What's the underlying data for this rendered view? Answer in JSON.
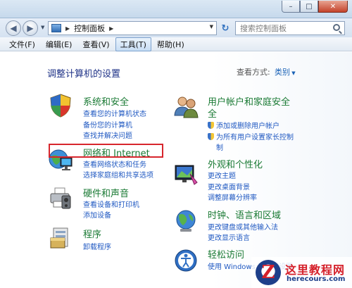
{
  "window": {
    "controls": {
      "min": "–",
      "max": "□",
      "close": "✕"
    }
  },
  "address_bar": {
    "location": "控制面板",
    "search_placeholder": "搜索控制面板"
  },
  "menu": [
    "文件(F)",
    "编辑(E)",
    "查看(V)",
    "工具(T)",
    "帮助(H)"
  ],
  "menu_active_index": 3,
  "main": {
    "title": "调整计算机的设置",
    "view_by_label": "查看方式:",
    "view_by_value": "类别"
  },
  "categories_left": [
    {
      "title": "系统和安全",
      "links": [
        "查看您的计算机状态",
        "备份您的计算机",
        "查找并解决问题"
      ],
      "icon": "shield-icon"
    },
    {
      "title": "网络和 Internet",
      "links": [
        "查看网络状态和任务",
        "选择家庭组和共享选项"
      ],
      "icon": "network-icon"
    },
    {
      "title": "硬件和声音",
      "links": [
        "查看设备和打印机",
        "添加设备"
      ],
      "icon": "printer-icon"
    },
    {
      "title": "程序",
      "links": [
        "卸载程序"
      ],
      "icon": "programs-icon"
    }
  ],
  "categories_right": [
    {
      "title": "用户帐户和家庭安全",
      "links": [
        "添加或删除用户帐户",
        "为所有用户设置家长控制"
      ],
      "icon": "users-icon"
    },
    {
      "title": "外观和个性化",
      "links": [
        "更改主题",
        "更改桌面背景",
        "调整屏幕分辨率"
      ],
      "icon": "appearance-icon"
    },
    {
      "title": "时钟、语言和区域",
      "links": [
        "更改键盘或其他输入法",
        "更改显示语言"
      ],
      "icon": "globe-icon"
    },
    {
      "title": "轻松访问",
      "links": [
        "使用 Windows 建议的设置"
      ],
      "icon": "ease-of-access-icon"
    }
  ],
  "watermark": {
    "title": "这里教程网",
    "subtitle": "herecours.com",
    "logo_letter": "Z"
  },
  "colors": {
    "category_title": "#1a7a34",
    "link": "#2059c2",
    "page_title": "#1e3287",
    "highlight": "#d7262d"
  }
}
